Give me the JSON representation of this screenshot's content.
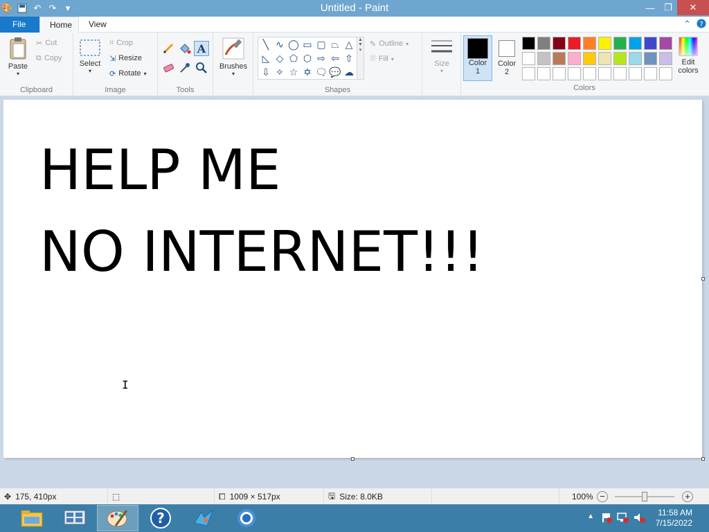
{
  "window": {
    "title": "Untitled - Paint"
  },
  "tabs": [
    {
      "label": "File"
    },
    {
      "label": "Home"
    },
    {
      "label": "View"
    }
  ],
  "ribbon": {
    "clipboard": {
      "paste": "Paste",
      "cut": "Cut",
      "copy": "Copy",
      "label": "Clipboard"
    },
    "image": {
      "select": "Select",
      "crop": "Crop",
      "resize": "Resize",
      "rotate": "Rotate",
      "label": "Image"
    },
    "tools": {
      "label": "Tools"
    },
    "brushes": {
      "label": "Brushes"
    },
    "shapes": {
      "outline": "Outline",
      "fill": "Fill",
      "label": "Shapes"
    },
    "size": {
      "label": "Size"
    },
    "colors": {
      "color1": "Color",
      "color1_num": "1",
      "color2": "Color",
      "color2_num": "2",
      "edit": "Edit",
      "edit2": "colors",
      "label": "Colors",
      "color1_value": "#000000",
      "color2_value": "#ffffff",
      "palette_row1": [
        "#000000",
        "#7f7f7f",
        "#880015",
        "#ed1c24",
        "#ff7f27",
        "#fff200",
        "#22b14c",
        "#00a2e8",
        "#3f48cc",
        "#a349a4"
      ],
      "palette_row2": [
        "#ffffff",
        "#c3c3c3",
        "#b97a57",
        "#ffaec9",
        "#ffc90e",
        "#efe4b0",
        "#b5e61d",
        "#99d9ea",
        "#7092be",
        "#c8bfe7"
      ],
      "palette_row3": [
        "#ffffff",
        "#ffffff",
        "#ffffff",
        "#ffffff",
        "#ffffff",
        "#ffffff",
        "#ffffff",
        "#ffffff",
        "#ffffff",
        "#ffffff"
      ]
    }
  },
  "canvas": {
    "line1": "HELP ME",
    "line2": "NO INTERNET!!!"
  },
  "status": {
    "cursor_pos": "175, 410px",
    "canvas_size": "1009 × 517px",
    "file_size": "Size: 8.0KB",
    "zoom": "100%"
  },
  "taskbar": {
    "time": "11:58 AM",
    "date": "7/15/2022"
  }
}
